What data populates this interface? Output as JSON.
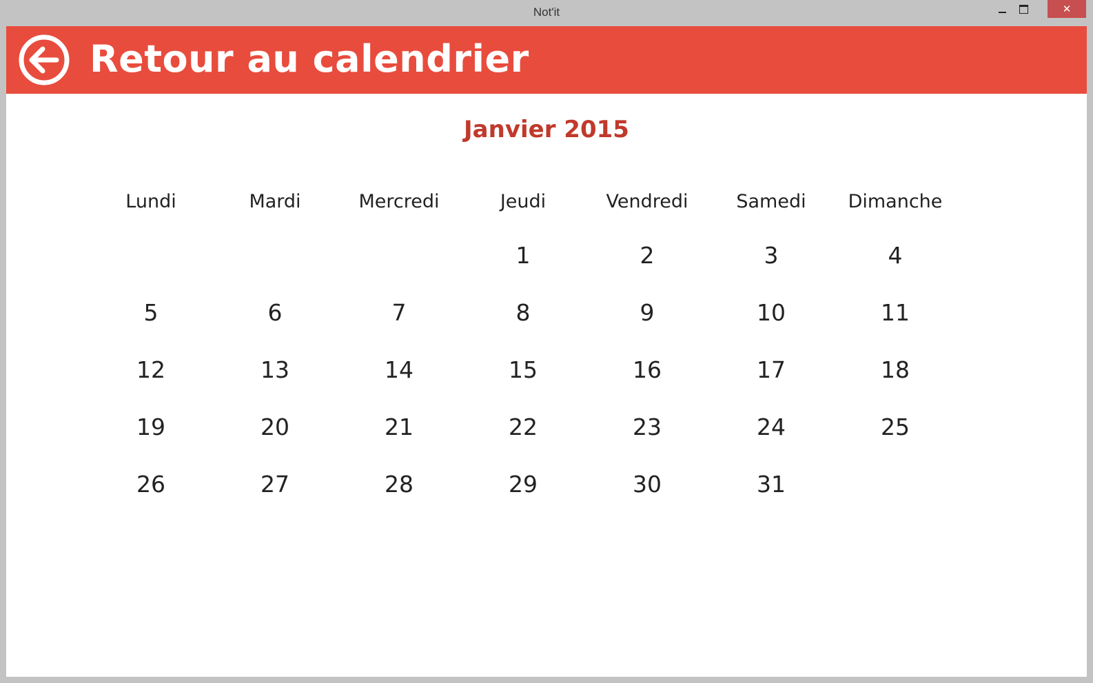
{
  "window": {
    "title": "Not'it",
    "close_glyph": "✕"
  },
  "header": {
    "back_icon": "arrow-left-circle-icon",
    "title": "Retour au calendrier",
    "accent_color": "#e84c3d"
  },
  "calendar": {
    "month_title": "Janvier 2015",
    "month_color": "#c0392b",
    "weekdays": [
      "Lundi",
      "Mardi",
      "Mercredi",
      "Jeudi",
      "Vendredi",
      "Samedi",
      "Dimanche"
    ],
    "weeks": [
      [
        "",
        "",
        "",
        "1",
        "2",
        "3",
        "4"
      ],
      [
        "5",
        "6",
        "7",
        "8",
        "9",
        "10",
        "11"
      ],
      [
        "12",
        "13",
        "14",
        "15",
        "16",
        "17",
        "18"
      ],
      [
        "19",
        "20",
        "21",
        "22",
        "23",
        "24",
        "25"
      ],
      [
        "26",
        "27",
        "28",
        "29",
        "30",
        "31",
        ""
      ]
    ]
  }
}
